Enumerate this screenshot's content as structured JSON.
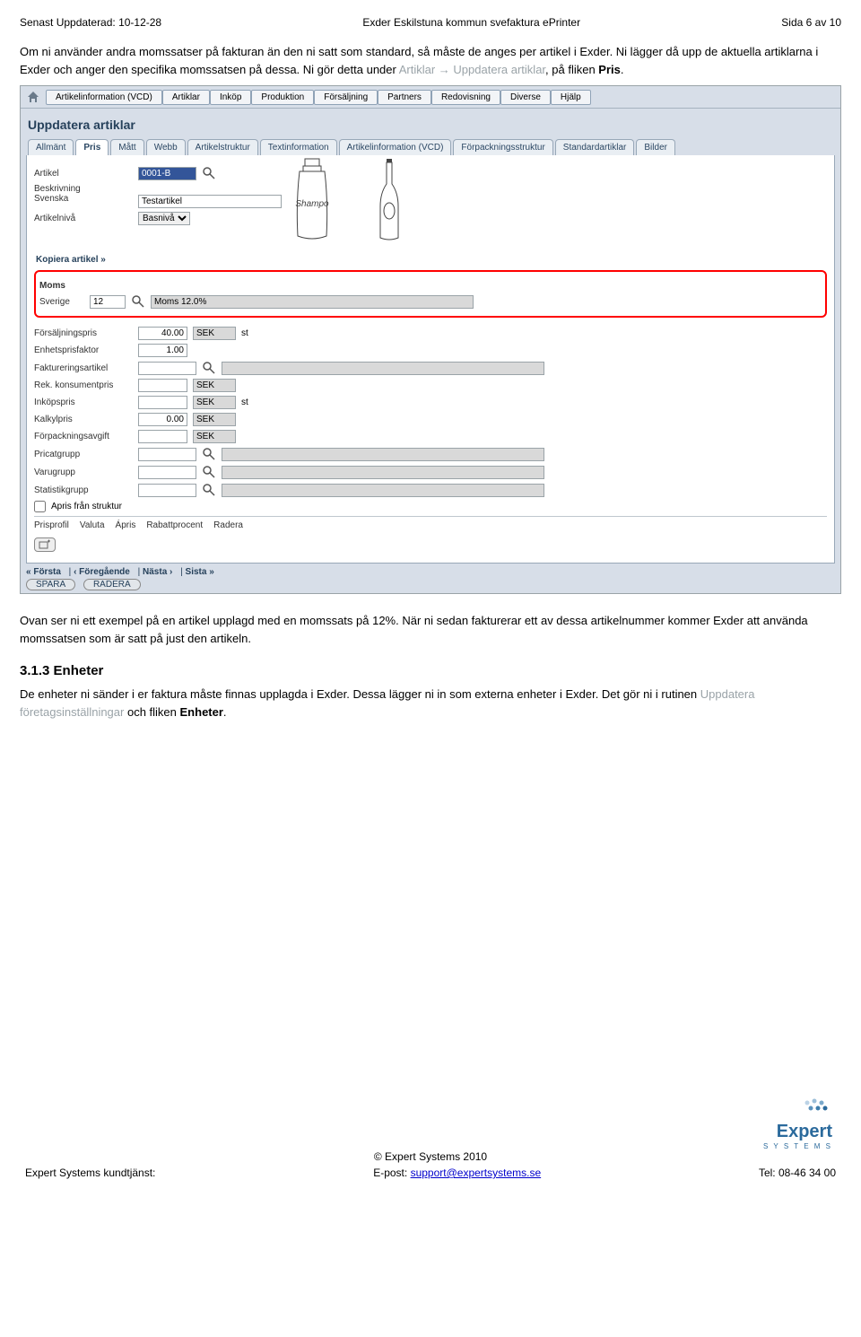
{
  "header": {
    "left": "Senast Uppdaterad: 10-12-28",
    "center": "Exder Eskilstuna kommun svefaktura ePrinter",
    "right": "Sida 6 av 10"
  },
  "intro": {
    "p1_a": "Om ni använder andra momssatser på fakturan än den ni satt som standard, så måste de anges per artikel i Exder. Ni lägger då upp de aktuella artiklarna i Exder och anger den specifika momssatsen på dessa. Ni gör detta under ",
    "p1_grey": "Artiklar → Uppdatera artiklar",
    "p1_b": ", på fliken ",
    "p1_bold": "Pris",
    "p1_end": "."
  },
  "menu": [
    "Artikelinformation (VCD)",
    "Artiklar",
    "Inköp",
    "Produktion",
    "Försäljning",
    "Partners",
    "Redovisning",
    "Diverse",
    "Hjälp"
  ],
  "panel_title": "Uppdatera artiklar",
  "tabs": [
    "Allmänt",
    "Pris",
    "Mått",
    "Webb",
    "Artikelstruktur",
    "Textinformation",
    "Artikelinformation (VCD)",
    "Förpackningsstruktur",
    "Standardartiklar",
    "Bilder"
  ],
  "active_tab_index": 1,
  "form": {
    "artikel_label": "Artikel",
    "artikel_value": "0001-B",
    "beskrivning_label": "Beskrivning",
    "svenska_label": "Svenska",
    "svenska_value": "Testartikel",
    "artikelniva_label": "Artikelnivå",
    "artikelniva_value": "Basnivå",
    "kopiera_link": "Kopiera artikel »",
    "moms_section": "Moms",
    "sverige_label": "Sverige",
    "sverige_code": "12",
    "sverige_desc": "Moms 12.0%",
    "rows": [
      {
        "label": "Försäljningspris",
        "val": "40.00",
        "unit": "SEK",
        "suffix": "st"
      },
      {
        "label": "Enhetsprisfaktor",
        "val": "1.00",
        "unit": "",
        "suffix": ""
      },
      {
        "label": "Faktureringsartikel",
        "val": "",
        "unit": "",
        "suffix": "",
        "lookup": true,
        "long": true
      },
      {
        "label": "Rek. konsumentpris",
        "val": "",
        "unit": "SEK",
        "suffix": ""
      },
      {
        "label": "Inköpspris",
        "val": "",
        "unit": "SEK",
        "suffix": "st"
      },
      {
        "label": "Kalkylpris",
        "val": "0.00",
        "unit": "SEK",
        "suffix": ""
      },
      {
        "label": "Förpackningsavgift",
        "val": "",
        "unit": "SEK",
        "suffix": ""
      },
      {
        "label": "Pricatgrupp",
        "val": "",
        "unit": "",
        "suffix": "",
        "lookup": true,
        "long": true
      },
      {
        "label": "Varugrupp",
        "val": "",
        "unit": "",
        "suffix": "",
        "lookup": true,
        "long": true
      },
      {
        "label": "Statistikgrupp",
        "val": "",
        "unit": "",
        "suffix": "",
        "lookup": true,
        "long": true
      }
    ],
    "apris_label": "Apris från struktur",
    "grid_headers": [
      "Prisprofil",
      "Valuta",
      "Ápris",
      "Rabattprocent",
      "Radera"
    ]
  },
  "nav": {
    "first": "« Första",
    "prev": "‹ Föregående",
    "next": "Nästa ›",
    "last": "Sista »",
    "spara": "SPARA",
    "radera": "RADERA"
  },
  "after": {
    "p1": "Ovan ser ni ett exempel på en artikel upplagd med en momssats på 12%. När ni sedan fakturerar ett av dessa artikelnummer kommer Exder att använda momssatsen som är satt på just den artikeln."
  },
  "section": {
    "heading": "3.1.3  Enheter",
    "p1_a": "De enheter ni sänder i er faktura måste finnas upplagda i Exder. Dessa lägger ni in som externa enheter i Exder. Det gör ni i rutinen ",
    "p1_grey": "Uppdatera företagsinställningar",
    "p1_b": " och fliken ",
    "p1_bold": "Enheter",
    "p1_end": "."
  },
  "footer": {
    "copyright": "© Expert Systems 2010",
    "left": "Expert Systems kundtjänst:",
    "mid_label": "E-post: ",
    "mid_link": "support@expertsystems.se",
    "right": "Tel: 08-46 34 00",
    "logo_top": "Expert",
    "logo_sub": "S Y S T E M S"
  }
}
